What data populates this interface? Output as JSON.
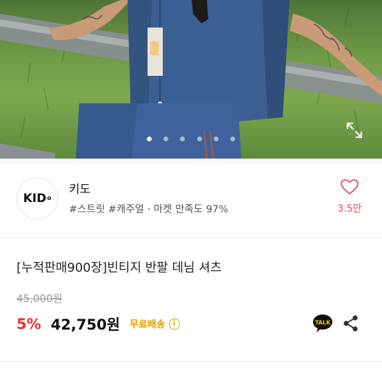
{
  "gallery": {
    "dot_count": 6,
    "active_index": 0
  },
  "shop": {
    "logo_text": "KID",
    "logo_mark": "o",
    "name": "키도",
    "tags": "#스트릿 #캐주얼 · 마켓 만족도 97%",
    "like_count": "3.5만"
  },
  "product": {
    "title": "[누적판매900장]빈티지 반팔 데님 셔츠",
    "original_price": "45,000원",
    "discount": "5%",
    "price": "42,750원",
    "shipping": "무료배송",
    "info_glyph": "i"
  },
  "actions": {
    "talk_label": "TALK"
  },
  "colors": {
    "discount": "#e5322d",
    "shipping": "#e0a100",
    "like": "#e84a5f",
    "talk_bg": "#f6d500"
  }
}
